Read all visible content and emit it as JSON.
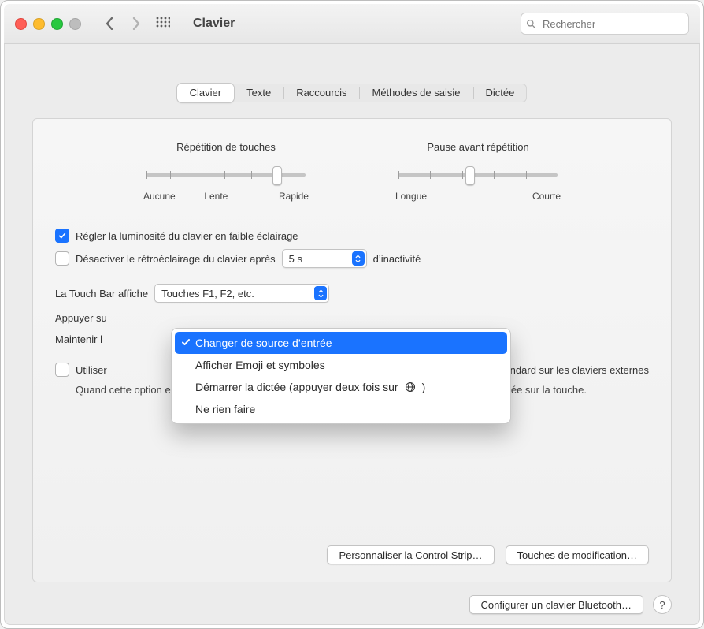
{
  "window": {
    "title": "Clavier"
  },
  "toolbar": {
    "search_placeholder": "Rechercher"
  },
  "tabs": [
    "Clavier",
    "Texte",
    "Raccourcis",
    "Méthodes de saisie",
    "Dictée"
  ],
  "active_tab_index": 0,
  "sliders": {
    "key_repeat": {
      "label": "Répétition de touches",
      "left": "Aucune",
      "mid": "Lente",
      "right": "Rapide",
      "value_fraction": 0.82
    },
    "delay": {
      "label": "Pause avant répétition",
      "left": "Longue",
      "right": "Courte",
      "value_fraction": 0.45
    }
  },
  "check_brightness": {
    "label": "Régler la luminosité du clavier en faible éclairage",
    "checked": true
  },
  "check_backlight": {
    "label_before": "Désactiver le rétroéclairage du clavier après",
    "select_value": "5 s",
    "label_after": "d’inactivité",
    "checked": false
  },
  "touchbar": {
    "label_before": "La Touch Bar affiche",
    "select_value": "Touches F1, F2, etc."
  },
  "press_fn": {
    "label_before": "Appuyer su"
  },
  "hold_fn": {
    "label_before": "Maintenir l"
  },
  "use_fn_keys": {
    "checked": false,
    "label_right": "standard sur les claviers externes",
    "label_left_truncated": "Utiliser",
    "hint": "Quand cette option est sélectionnée, appuyez sur la touche Fn pour utiliser la fonction représentée sur la touche."
  },
  "buttons": {
    "control_strip": "Personnaliser la Control Strip…",
    "modifier_keys": "Touches de modification…",
    "bluetooth": "Configurer un clavier Bluetooth…",
    "help_glyph": "?"
  },
  "menu": {
    "items": [
      "Changer de source d’entrée",
      "Afficher Emoji et symboles",
      "Démarrer la dictée (appuyer deux fois sur ",
      "Ne rien faire"
    ],
    "globe_close": " )",
    "selected_index": 0
  }
}
